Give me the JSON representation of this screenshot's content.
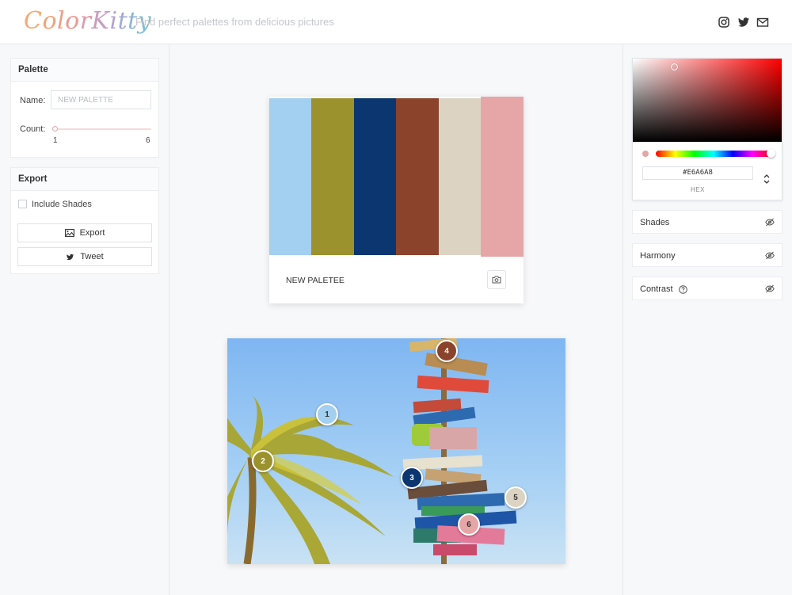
{
  "header": {
    "logo_letters": [
      "C",
      "o",
      "l",
      "o",
      "r",
      "K",
      "i",
      "t",
      "t",
      "y"
    ],
    "logo_colors": [
      "#f5a973",
      "#f4a377",
      "#f19d83",
      "#ec9a94",
      "#e199ab",
      "#c99ec0",
      "#b2a3cc",
      "#9eaad3",
      "#8bb3d6",
      "#7fbcd5"
    ],
    "tagline": "Find perfect palettes from delicious pictures",
    "social_icons": [
      "instagram-icon",
      "twitter-icon",
      "mail-icon"
    ]
  },
  "palette_panel": {
    "title": "Palette",
    "name_label": "Name:",
    "name_placeholder": "NEW PALETTE",
    "count_label": "Count:",
    "count_min": "1",
    "count_max": "6",
    "count_value": 1
  },
  "export_panel": {
    "title": "Export",
    "include_shades_label": "Include Shades",
    "include_shades_checked": false,
    "export_label": "Export",
    "tweet_label": "Tweet"
  },
  "palette": {
    "name": "NEW PALETEE",
    "colors": [
      "#a3cff0",
      "#9c922d",
      "#0b3670",
      "#8c432b",
      "#dcd3c3",
      "#e6a6a8"
    ],
    "selected_index": 5
  },
  "markers": [
    {
      "number": "1",
      "color": "#a3cff0"
    },
    {
      "number": "2",
      "color": "#9c922d"
    },
    {
      "number": "3",
      "color": "#0b3670"
    },
    {
      "number": "4",
      "color": "#8c432b"
    },
    {
      "number": "5",
      "color": "#dcd3c3"
    },
    {
      "number": "6",
      "color": "#e6a6a8"
    }
  ],
  "picker": {
    "hex_value": "#E6A6A8",
    "format_label": "HEX",
    "current_color": "#e6a6a8"
  },
  "sections": {
    "shades": "Shades",
    "harmony": "Harmony",
    "contrast": "Contrast"
  }
}
